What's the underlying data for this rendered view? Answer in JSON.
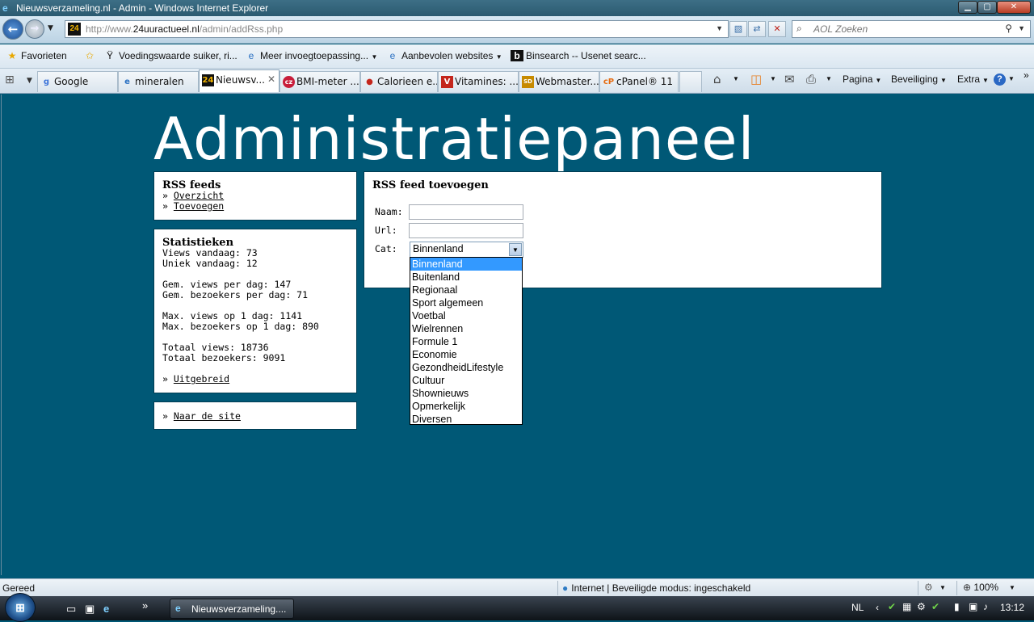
{
  "window": {
    "title": "Nieuwsverzameling.nl - Admin - Windows Internet Explorer",
    "minimize": "▁",
    "maximize": "▢",
    "close": "✕"
  },
  "nav": {
    "back_icon": "arrow-left-icon",
    "forward_icon": "arrow-right-icon",
    "url_prefix": "http://www.",
    "url_domain": "24uuractueel.nl",
    "url_path": "/admin/addRss.php",
    "site_favicon": "24",
    "search_placeholder": "AOL Zoeken"
  },
  "favorites": {
    "label": "Favorieten",
    "items": [
      "Voedingswaarde suiker, ri...",
      "Meer invoegtoepassing...",
      "Aanbevolen websites",
      "Binsearch -- Usenet searc..."
    ]
  },
  "tabs": [
    {
      "label": "Google",
      "icon": "g"
    },
    {
      "label": "mineralen",
      "icon": "e"
    },
    {
      "label": "Nieuwsv...",
      "icon": "24",
      "active": true
    },
    {
      "label": "BMI-meter ...",
      "icon": "cz"
    },
    {
      "label": "Calorieen e...",
      "icon": "●"
    },
    {
      "label": "Vitamines: ...",
      "icon": "V"
    },
    {
      "label": "Webmaster...",
      "icon": "SD"
    },
    {
      "label": "cPanel® 11",
      "icon": "cP"
    }
  ],
  "commandbar": {
    "page": "Pagina",
    "security": "Beveiliging",
    "extra": "Extra",
    "help": "?"
  },
  "page": {
    "title": "Administratiepaneel",
    "rss_box": {
      "heading": "RSS feeds",
      "links": [
        "Overzicht",
        "Toevoegen"
      ]
    },
    "stats_box": {
      "heading": "Statistieken",
      "views_today": "Views vandaag: 73",
      "unique_today": "Uniek vandaag: 12",
      "avg_views": "Gem. views per dag: 147",
      "avg_visitors": "Gem. bezoekers per dag: 71",
      "max_views": "Max. views op 1 dag: 1141",
      "max_visitors": "Max. bezoekers op 1 dag: 890",
      "total_views": "Totaal views: 18736",
      "total_visitors": "Totaal bezoekers: 9091",
      "more_link": "Uitgebreid"
    },
    "site_box": {
      "link": "Naar de site"
    },
    "form": {
      "heading": "RSS feed toevoegen",
      "name_label": "Naam:",
      "url_label": "Url:",
      "cat_label": "Cat:",
      "name_value": "",
      "url_value": "",
      "cat_selected": "Binnenland",
      "cat_options": [
        "Binnenland",
        "Buitenland",
        "Regionaal",
        "Sport algemeen",
        "Voetbal",
        "Wielrennen",
        "Formule 1",
        "Economie",
        "GezondheidLifestyle",
        "Cultuur",
        "Shownieuws",
        "Opmerkelijk",
        "Diversen"
      ]
    }
  },
  "status": {
    "text": "Gereed",
    "zone": "Internet | Beveiligde modus: ingeschakeld",
    "zoom": "100%"
  },
  "taskbar": {
    "task": "Nieuwsverzameling....",
    "language": "NL",
    "clock": "13:12"
  },
  "colors": {
    "page_bg": "#005876",
    "select_highlight": "#3399ff"
  }
}
